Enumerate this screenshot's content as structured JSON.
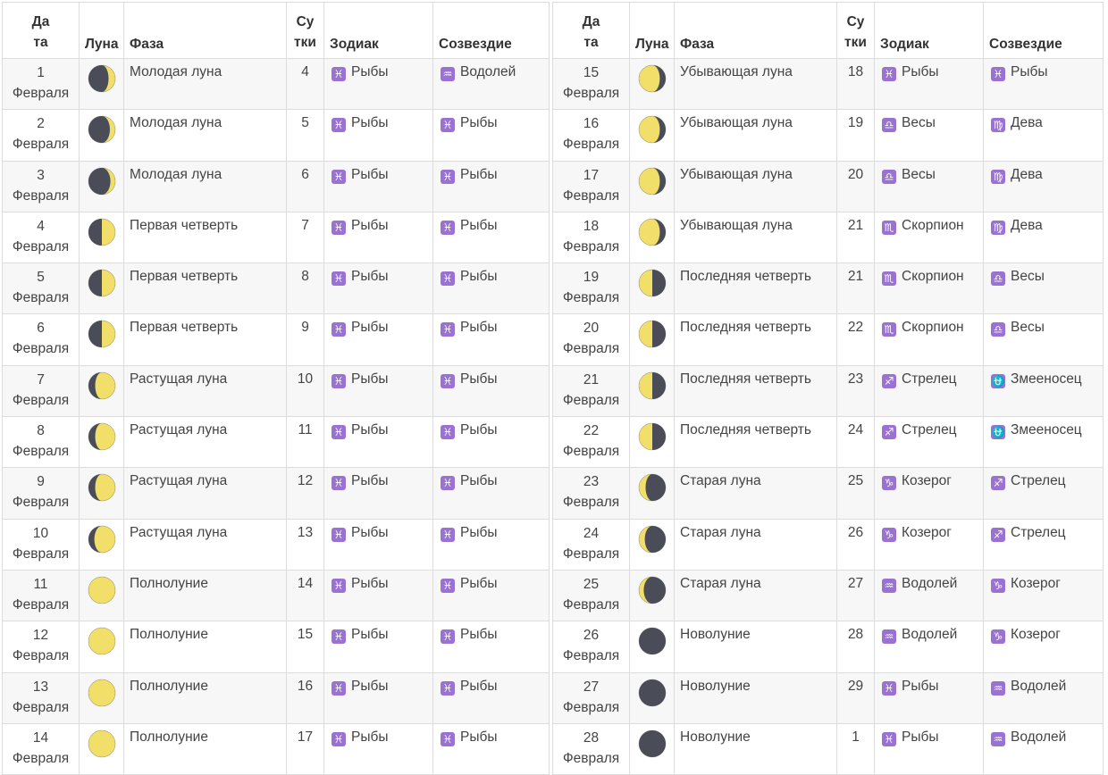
{
  "headers": {
    "date_1": "Да",
    "date_2": "та",
    "moon": "Луна",
    "phase": "Фаза",
    "day_1": "Су",
    "day_2": "тки",
    "zodiac": "Зодиак",
    "constellation": "Созвездие"
  },
  "colors": {
    "badge": "#9a72d2",
    "moon_light": "#f2df6a",
    "moon_dark": "#4a4d57",
    "row_alt": "#f7f7f7"
  },
  "signs": {
    "Рыбы": "♓",
    "Водолей": "♒",
    "Весы": "♎",
    "Дева": "♍",
    "Скорпион": "♏",
    "Стрелец": "♐",
    "Змееносец": "⛎",
    "Козерог": "♑"
  },
  "rows": [
    {
      "day_num": "1",
      "month": "Февраля",
      "moon": "waxing-crescent-icon",
      "illum": 0.25,
      "waxing": true,
      "phase": "Молодая луна",
      "lunar_day": "4",
      "zodiac": "Рыбы",
      "constellation": "Водолей"
    },
    {
      "day_num": "2",
      "month": "Февраля",
      "moon": "waxing-crescent-icon",
      "illum": 0.2,
      "waxing": true,
      "phase": "Молодая луна",
      "lunar_day": "5",
      "zodiac": "Рыбы",
      "constellation": "Рыбы"
    },
    {
      "day_num": "3",
      "month": "Февраля",
      "moon": "waxing-crescent-icon",
      "illum": 0.18,
      "waxing": true,
      "phase": "Молодая луна",
      "lunar_day": "6",
      "zodiac": "Рыбы",
      "constellation": "Рыбы"
    },
    {
      "day_num": "4",
      "month": "Февраля",
      "moon": "first-quarter-moon-icon",
      "illum": 0.5,
      "waxing": true,
      "phase": "Первая четверть",
      "lunar_day": "7",
      "zodiac": "Рыбы",
      "constellation": "Рыбы"
    },
    {
      "day_num": "5",
      "month": "Февраля",
      "moon": "first-quarter-moon-icon",
      "illum": 0.5,
      "waxing": true,
      "phase": "Первая четверть",
      "lunar_day": "8",
      "zodiac": "Рыбы",
      "constellation": "Рыбы"
    },
    {
      "day_num": "6",
      "month": "Февраля",
      "moon": "first-quarter-moon-icon",
      "illum": 0.5,
      "waxing": true,
      "phase": "Первая четверть",
      "lunar_day": "9",
      "zodiac": "Рыбы",
      "constellation": "Рыбы"
    },
    {
      "day_num": "7",
      "month": "Февраля",
      "moon": "waxing-gibbous-icon",
      "illum": 0.75,
      "waxing": true,
      "phase": "Растущая луна",
      "lunar_day": "10",
      "zodiac": "Рыбы",
      "constellation": "Рыбы"
    },
    {
      "day_num": "8",
      "month": "Февраля",
      "moon": "waxing-gibbous-icon",
      "illum": 0.75,
      "waxing": true,
      "phase": "Растущая луна",
      "lunar_day": "11",
      "zodiac": "Рыбы",
      "constellation": "Рыбы"
    },
    {
      "day_num": "9",
      "month": "Февраля",
      "moon": "waxing-gibbous-icon",
      "illum": 0.75,
      "waxing": true,
      "phase": "Растущая луна",
      "lunar_day": "12",
      "zodiac": "Рыбы",
      "constellation": "Рыбы"
    },
    {
      "day_num": "10",
      "month": "Февраля",
      "moon": "waxing-gibbous-icon",
      "illum": 0.78,
      "waxing": true,
      "phase": "Растущая луна",
      "lunar_day": "13",
      "zodiac": "Рыбы",
      "constellation": "Рыбы"
    },
    {
      "day_num": "11",
      "month": "Февраля",
      "moon": "full-moon-icon",
      "illum": 1,
      "waxing": true,
      "phase": "Полнолуние",
      "lunar_day": "14",
      "zodiac": "Рыбы",
      "constellation": "Рыбы"
    },
    {
      "day_num": "12",
      "month": "Февраля",
      "moon": "full-moon-icon",
      "illum": 1,
      "waxing": true,
      "phase": "Полнолуние",
      "lunar_day": "15",
      "zodiac": "Рыбы",
      "constellation": "Рыбы"
    },
    {
      "day_num": "13",
      "month": "Февраля",
      "moon": "full-moon-icon",
      "illum": 1,
      "waxing": true,
      "phase": "Полнолуние",
      "lunar_day": "16",
      "zodiac": "Рыбы",
      "constellation": "Рыбы"
    },
    {
      "day_num": "14",
      "month": "Февраля",
      "moon": "full-moon-icon",
      "illum": 1,
      "waxing": true,
      "phase": "Полнолуние",
      "lunar_day": "17",
      "zodiac": "Рыбы",
      "constellation": "Рыбы"
    },
    {
      "day_num": "15",
      "month": "Февраля",
      "moon": "waning-gibbous-icon",
      "illum": 0.78,
      "waxing": false,
      "phase": "Убывающая луна",
      "lunar_day": "18",
      "zodiac": "Рыбы",
      "constellation": "Рыбы"
    },
    {
      "day_num": "16",
      "month": "Февраля",
      "moon": "waning-gibbous-icon",
      "illum": 0.78,
      "waxing": false,
      "phase": "Убывающая луна",
      "lunar_day": "19",
      "zodiac": "Весы",
      "constellation": "Дева"
    },
    {
      "day_num": "17",
      "month": "Февраля",
      "moon": "waning-gibbous-icon",
      "illum": 0.78,
      "waxing": false,
      "phase": "Убывающая луна",
      "lunar_day": "20",
      "zodiac": "Весы",
      "constellation": "Дева"
    },
    {
      "day_num": "18",
      "month": "Февраля",
      "moon": "waning-gibbous-icon",
      "illum": 0.78,
      "waxing": false,
      "phase": "Убывающая луна",
      "lunar_day": "21",
      "zodiac": "Скорпион",
      "constellation": "Дева"
    },
    {
      "day_num": "19",
      "month": "Февраля",
      "moon": "last-quarter-moon-icon",
      "illum": 0.5,
      "waxing": false,
      "phase": "Последняя четверть",
      "lunar_day": "21",
      "zodiac": "Скорпион",
      "constellation": "Весы"
    },
    {
      "day_num": "20",
      "month": "Февраля",
      "moon": "last-quarter-moon-icon",
      "illum": 0.5,
      "waxing": false,
      "phase": "Последняя четверть",
      "lunar_day": "22",
      "zodiac": "Скорпион",
      "constellation": "Весы"
    },
    {
      "day_num": "21",
      "month": "Февраля",
      "moon": "last-quarter-moon-icon",
      "illum": 0.5,
      "waxing": false,
      "phase": "Последняя четверть",
      "lunar_day": "23",
      "zodiac": "Стрелец",
      "constellation": "Змееносец"
    },
    {
      "day_num": "22",
      "month": "Февраля",
      "moon": "last-quarter-moon-icon",
      "illum": 0.5,
      "waxing": false,
      "phase": "Последняя четверть",
      "lunar_day": "24",
      "zodiac": "Стрелец",
      "constellation": "Змееносец"
    },
    {
      "day_num": "23",
      "month": "Февраля",
      "moon": "waning-crescent-icon",
      "illum": 0.25,
      "waxing": false,
      "phase": "Старая луна",
      "lunar_day": "25",
      "zodiac": "Козерог",
      "constellation": "Стрелец"
    },
    {
      "day_num": "24",
      "month": "Февраля",
      "moon": "waning-crescent-icon",
      "illum": 0.22,
      "waxing": false,
      "phase": "Старая луна",
      "lunar_day": "26",
      "zodiac": "Козерог",
      "constellation": "Стрелец"
    },
    {
      "day_num": "25",
      "month": "Февраля",
      "moon": "waning-crescent-icon",
      "illum": 0.18,
      "waxing": false,
      "phase": "Старая луна",
      "lunar_day": "27",
      "zodiac": "Водолей",
      "constellation": "Козерог"
    },
    {
      "day_num": "26",
      "month": "Февраля",
      "moon": "new-moon-icon",
      "illum": 0,
      "waxing": false,
      "phase": "Новолуние",
      "lunar_day": "28",
      "zodiac": "Водолей",
      "constellation": "Козерог"
    },
    {
      "day_num": "27",
      "month": "Февраля",
      "moon": "new-moon-icon",
      "illum": 0,
      "waxing": false,
      "phase": "Новолуние",
      "lunar_day": "29",
      "zodiac": "Рыбы",
      "constellation": "Водолей"
    },
    {
      "day_num": "28",
      "month": "Февраля",
      "moon": "new-moon-icon",
      "illum": 0,
      "waxing": false,
      "phase": "Новолуние",
      "lunar_day": "1",
      "zodiac": "Рыбы",
      "constellation": "Водолей"
    }
  ]
}
